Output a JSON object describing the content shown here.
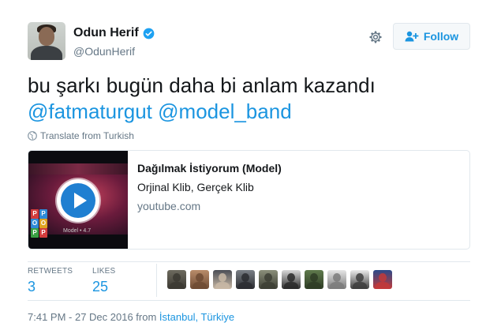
{
  "author": {
    "display_name": "Odun Herif",
    "handle": "@OdunHerif",
    "verified": true
  },
  "actions": {
    "follow_label": "Follow",
    "settings_icon": "gear-icon",
    "follow_icon": "user-plus-icon"
  },
  "tweet": {
    "text_plain": "bu şarkı bugün daha bi anlam kazandı",
    "mentions": [
      "@fatmaturgut",
      "@model_band"
    ],
    "translate_label": "Translate from Turkish"
  },
  "card": {
    "title": "Dağılmak İstiyorum (Model)",
    "description": "Orjinal Klib, Gerçek Klib",
    "domain": "youtube.com",
    "thumb_letters": [
      "P",
      "O",
      "P",
      "P",
      "O",
      "P"
    ],
    "thumb_caption": "Model • 4.7"
  },
  "stats": {
    "retweets_label": "RETWEETS",
    "retweets_count": "3",
    "likes_label": "LIKES",
    "likes_count": "25"
  },
  "likers": [
    {
      "color": "#6d6a5e",
      "accent": "#3c3a33"
    },
    {
      "color": "#b98c6a",
      "accent": "#6e4b34"
    },
    {
      "color": "#4a4d55",
      "accent": "#c9b9a6"
    },
    {
      "color": "#7a7f86",
      "accent": "#2b2d31"
    },
    {
      "color": "#8b8f7a",
      "accent": "#3d3f35"
    },
    {
      "color": "#d9d9d9",
      "accent": "#2a2a2a"
    },
    {
      "color": "#5f7a4c",
      "accent": "#2f3d26"
    },
    {
      "color": "#e6e6e6",
      "accent": "#7b7b7b"
    },
    {
      "color": "#ececec",
      "accent": "#3e3e3e"
    },
    {
      "color": "#2c4a8a",
      "accent": "#c23a3a"
    }
  ],
  "meta": {
    "time_date": "7:41 PM - 27 Dec 2016 from ",
    "location": "İstanbul, Türkiye"
  },
  "colors": {
    "link_blue": "#1b95e0",
    "muted_gray": "#657786",
    "border": "#e1e8ed"
  }
}
